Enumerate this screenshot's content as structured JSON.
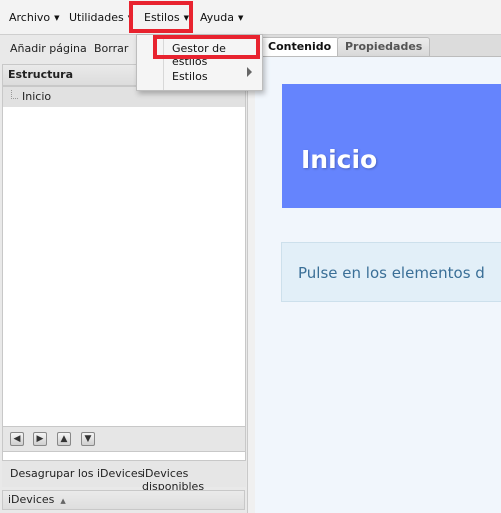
{
  "menubar": {
    "items": [
      {
        "label": "Archivo"
      },
      {
        "label": "Utilidades"
      },
      {
        "label": "Estilos"
      },
      {
        "label": "Ayuda"
      }
    ]
  },
  "estilos_menu": {
    "items": [
      {
        "label": "Gestor de estilos"
      },
      {
        "label": "Estilos"
      }
    ]
  },
  "left_panel": {
    "add_page_label": "Añadir página",
    "delete_label": "Borrar",
    "structure_title": "Estructura",
    "tree": [
      {
        "label": "Inicio"
      }
    ],
    "nav_buttons": [
      "left-arrow-icon",
      "right-arrow-icon",
      "up-arrow-icon",
      "down-arrow-icon"
    ],
    "idevices_ungroup_label": "Desagrupar los iDevices",
    "idevices_available_label": "iDevices disponibles",
    "idevices_header": "iDevices"
  },
  "tabs": [
    {
      "label": "Contenido",
      "active": true
    },
    {
      "label": "Propiedades",
      "active": false
    }
  ],
  "content": {
    "page_title": "Inicio",
    "info_text": "Pulse en los elementos d"
  },
  "colors": {
    "highlight": "#e8232f",
    "header_blue": "#6584fd",
    "info_bg": "#e2eff8"
  }
}
